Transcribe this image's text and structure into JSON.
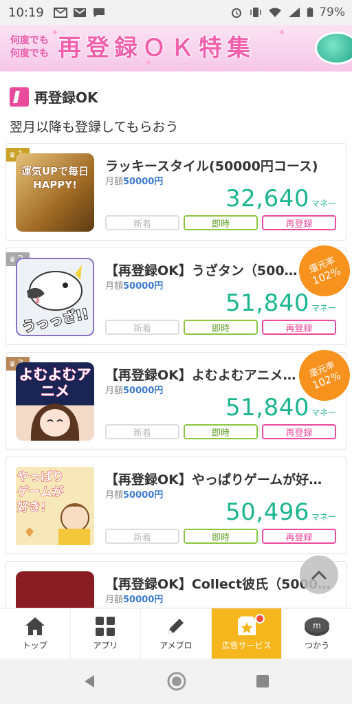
{
  "status_bar": {
    "time": "10:19",
    "battery": "79%",
    "icons_left": [
      "gmail-icon",
      "gmail-icon",
      "chat-icon"
    ],
    "icons_right": [
      "alarm-icon",
      "vibrate-icon",
      "wifi-icon",
      "signal-icon",
      "battery-icon"
    ]
  },
  "banner": {
    "subtitle_line1": "何度でも",
    "subtitle_line2": "何度でも",
    "title": "再登録ＯＫ特集"
  },
  "section": {
    "title": "再登録OK",
    "description": "翌月以降も登録してもらおう"
  },
  "labels": {
    "price_prefix": "月額",
    "money_unit": "マネー",
    "tag_new": "新着",
    "tag_now": "即時",
    "tag_re": "再登録",
    "rate_label": "還元率"
  },
  "items": [
    {
      "rank": "1",
      "rank_color": "#c9a227",
      "title": "ラッキースタイル(50000円コース)",
      "price": "50000円",
      "money": "32,640",
      "thumb_text": "運気UPで毎日HAPPY!",
      "thumb_color": "#b07a2a"
    },
    {
      "rank": "2",
      "rank_color": "#a7a7a7",
      "title": "【再登録OK】うざタン（500…",
      "price": "50000円",
      "money": "51,840",
      "rate": "102%",
      "thumb_text": "うっっざ!!",
      "thumb_color": "#e9f0f7"
    },
    {
      "rank": "3",
      "rank_color": "#b8875a",
      "title": "【再登録OK】よむよむアニメ…",
      "price": "50000円",
      "money": "51,840",
      "rate": "102%",
      "thumb_text": "よむよむアニメ",
      "thumb_color": "#222a55"
    },
    {
      "title": "【再登録OK】やっぱりゲームが好…",
      "price": "50000円",
      "money": "50,496",
      "thumb_text": "やっぱりゲームが好き!",
      "thumb_color": "#f7e6b5"
    },
    {
      "title": "【再登録OK】Collect彼氏（50000…",
      "price": "50000円",
      "money": "",
      "thumb_color": "#8a1d24"
    }
  ],
  "bottom_nav": [
    {
      "label": "トップ",
      "icon": "home-icon"
    },
    {
      "label": "アプリ",
      "icon": "apps-icon"
    },
    {
      "label": "アメブロ",
      "icon": "pencil-icon"
    },
    {
      "label": "広告サービス",
      "icon": "star-box-icon",
      "active": true
    },
    {
      "label": "つかう",
      "icon": "coin-icon"
    }
  ],
  "colors": {
    "accent_pink": "#e94a9b",
    "money_green": "#1bb58f",
    "nav_active": "#f5b61e",
    "rate_orange": "#f7921e"
  }
}
